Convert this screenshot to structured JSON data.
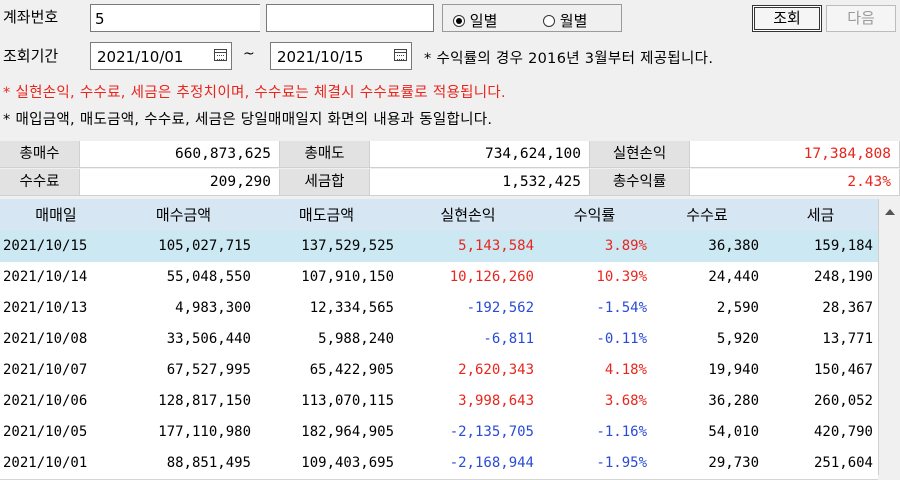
{
  "header": {
    "account_label": "계좌번호",
    "account_value": "5",
    "radio_daily": "일별",
    "radio_monthly": "월별",
    "query_button": "조회",
    "next_button": "다음",
    "period_label": "조회기간",
    "date_from": "2021/10/01",
    "date_sep": "~",
    "date_to": "2021/10/15",
    "period_note": "* 수익률의 경우 2016년 3월부터 제공됩니다."
  },
  "notes": {
    "warning": "* 실현손익, 수수료, 세금은 추정치이며, 수수료는 체결시 수수료률로 적용됩니다.",
    "info": "* 매입금액, 매도금액, 수수료, 세금은 당일매매일지 화면의 내용과 동일합니다."
  },
  "summary": {
    "total_buy_label": "총매수",
    "total_buy_value": "660,873,625",
    "total_sell_label": "총매도",
    "total_sell_value": "734,624,100",
    "realized_pl_label": "실현손익",
    "realized_pl_value": "17,384,808",
    "fee_label": "수수료",
    "fee_value": "209,290",
    "tax_sum_label": "세금합",
    "tax_sum_value": "1,532,425",
    "total_return_label": "총수익률",
    "total_return_value": "2.43%"
  },
  "table": {
    "columns": [
      "매매일",
      "매수금액",
      "매도금액",
      "실현손익",
      "수익률",
      "수수료",
      "세금"
    ],
    "rows": [
      {
        "date": "2021/10/15",
        "buy": "105,027,715",
        "sell": "137,529,525",
        "pl": "5,143,584",
        "ret": "3.89%",
        "fee": "36,380",
        "tax": "159,184",
        "sign": "pos"
      },
      {
        "date": "2021/10/14",
        "buy": "55,048,550",
        "sell": "107,910,150",
        "pl": "10,126,260",
        "ret": "10.39%",
        "fee": "24,440",
        "tax": "248,190",
        "sign": "pos"
      },
      {
        "date": "2021/10/13",
        "buy": "4,983,300",
        "sell": "12,334,565",
        "pl": "-192,562",
        "ret": "-1.54%",
        "fee": "2,590",
        "tax": "28,367",
        "sign": "neg"
      },
      {
        "date": "2021/10/08",
        "buy": "33,506,440",
        "sell": "5,988,240",
        "pl": "-6,811",
        "ret": "-0.11%",
        "fee": "5,920",
        "tax": "13,771",
        "sign": "neg"
      },
      {
        "date": "2021/10/07",
        "buy": "67,527,995",
        "sell": "65,422,905",
        "pl": "2,620,343",
        "ret": "4.18%",
        "fee": "19,940",
        "tax": "150,467",
        "sign": "pos"
      },
      {
        "date": "2021/10/06",
        "buy": "128,817,150",
        "sell": "113,070,115",
        "pl": "3,998,643",
        "ret": "3.68%",
        "fee": "36,280",
        "tax": "260,052",
        "sign": "pos"
      },
      {
        "date": "2021/10/05",
        "buy": "177,110,980",
        "sell": "182,964,905",
        "pl": "-2,135,705",
        "ret": "-1.16%",
        "fee": "54,010",
        "tax": "420,790",
        "sign": "neg"
      },
      {
        "date": "2021/10/01",
        "buy": "88,851,495",
        "sell": "109,403,695",
        "pl": "-2,168,944",
        "ret": "-1.95%",
        "fee": "29,730",
        "tax": "251,604",
        "sign": "neg"
      }
    ]
  },
  "colors": {
    "positive": "#e8261e",
    "negative": "#2a4bd7",
    "selected_row": "#cce8f3",
    "header_bg": "#d7e6f3"
  }
}
